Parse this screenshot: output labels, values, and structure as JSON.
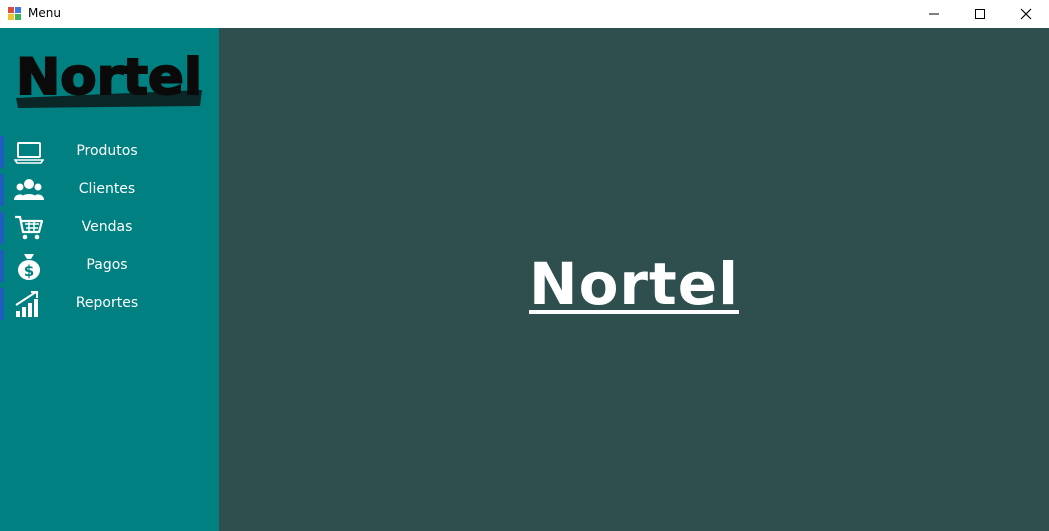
{
  "window": {
    "title": "Menu",
    "icon": "winforms-app-icon",
    "controls": [
      "minimize-icon",
      "maximize-icon",
      "close-icon"
    ]
  },
  "sidebar": {
    "background": "#008080",
    "accent": "#1e5cbe",
    "logo_text": "Nortel",
    "items": [
      {
        "label": "Produtos",
        "icon": "laptop-icon"
      },
      {
        "label": "Clientes",
        "icon": "users-icon"
      },
      {
        "label": "Vendas",
        "icon": "cart-icon"
      },
      {
        "label": "Pagos",
        "icon": "money-bag-icon"
      },
      {
        "label": "Reportes",
        "icon": "chart-bars-icon"
      }
    ]
  },
  "main": {
    "background": "#2f4f4f",
    "title": "Nortel"
  }
}
